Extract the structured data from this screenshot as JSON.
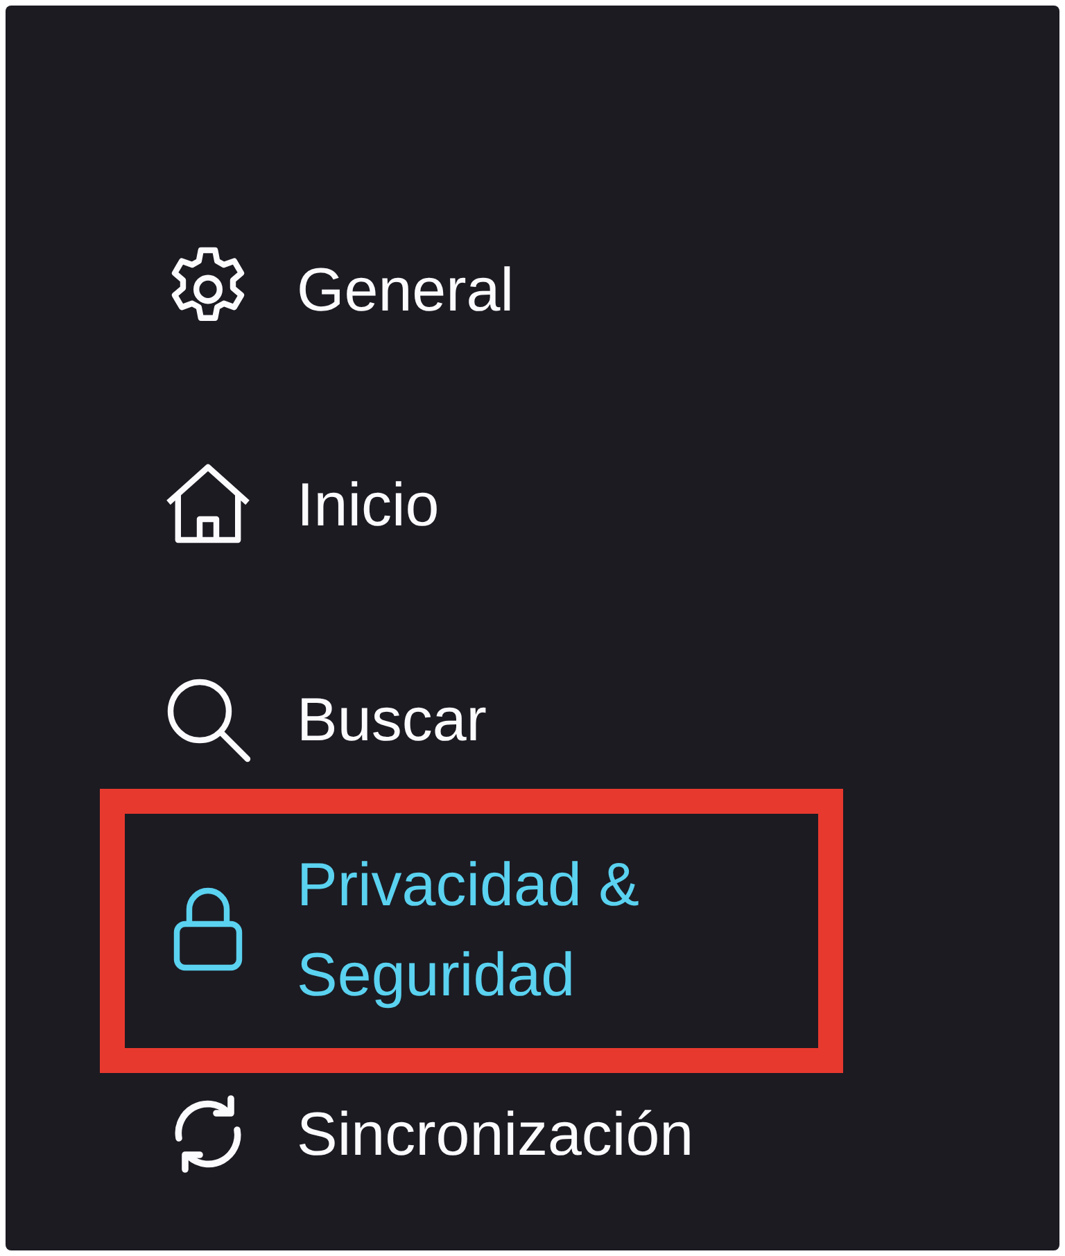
{
  "items": [
    {
      "label": "General",
      "kind": "gear",
      "selected": false,
      "highlighted": false
    },
    {
      "label": "Inicio",
      "kind": "home",
      "selected": false,
      "highlighted": false
    },
    {
      "label": "Buscar",
      "kind": "search",
      "selected": false,
      "highlighted": false
    },
    {
      "label": "Privacidad & Seguridad",
      "kind": "lock",
      "selected": true,
      "highlighted": true
    },
    {
      "label": "Sincronización",
      "kind": "sync",
      "selected": false,
      "highlighted": false
    }
  ]
}
